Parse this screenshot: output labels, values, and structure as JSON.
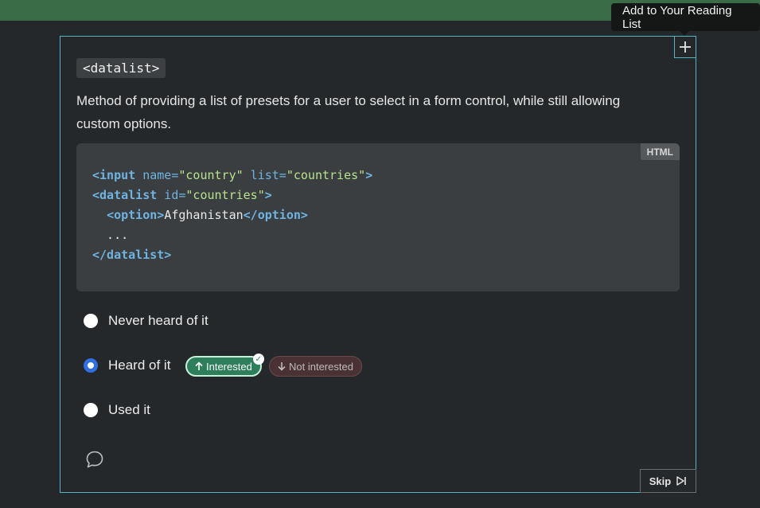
{
  "tooltip": {
    "text": "Add to Your Reading List"
  },
  "card": {
    "feature_tag": "<datalist>",
    "description": "Method of providing a list of presets for a user to select in a form control, while still allowing custom options.",
    "code_language": "HTML",
    "code": {
      "line1": {
        "tag_open": "<input",
        "attr1": " name=",
        "val1": "\"country\"",
        "attr2": " list=",
        "val2": "\"countries\"",
        "tag_close": ">"
      },
      "line2": {
        "tag_open": "<datalist",
        "attr1": " id=",
        "val1": "\"countries\"",
        "tag_close": ">"
      },
      "line3": {
        "indent": "  ",
        "tag_open": "<option>",
        "text": "Afghanistan",
        "tag_close": "</option>"
      },
      "line4": {
        "text": "  ..."
      },
      "line5": {
        "tag": "</datalist>"
      }
    },
    "options": [
      {
        "label": "Never heard of it",
        "selected": false
      },
      {
        "label": "Heard of it",
        "selected": true
      },
      {
        "label": "Used it",
        "selected": false
      }
    ],
    "interest": {
      "interested_label": "Interested",
      "interested_icon": "arrow-up-icon",
      "not_interested_label": "Not interested",
      "not_interested_icon": "arrow-down-icon",
      "selected": "interested"
    },
    "skip_label": "Skip"
  },
  "colors": {
    "background": "#25282a",
    "topbar": "#3a6d47",
    "card_border": "#4fb8c4",
    "radio_selected": "#2f6fe0",
    "interested_pill": "#2e7d5b",
    "not_interested_pill": "#4a3234"
  }
}
